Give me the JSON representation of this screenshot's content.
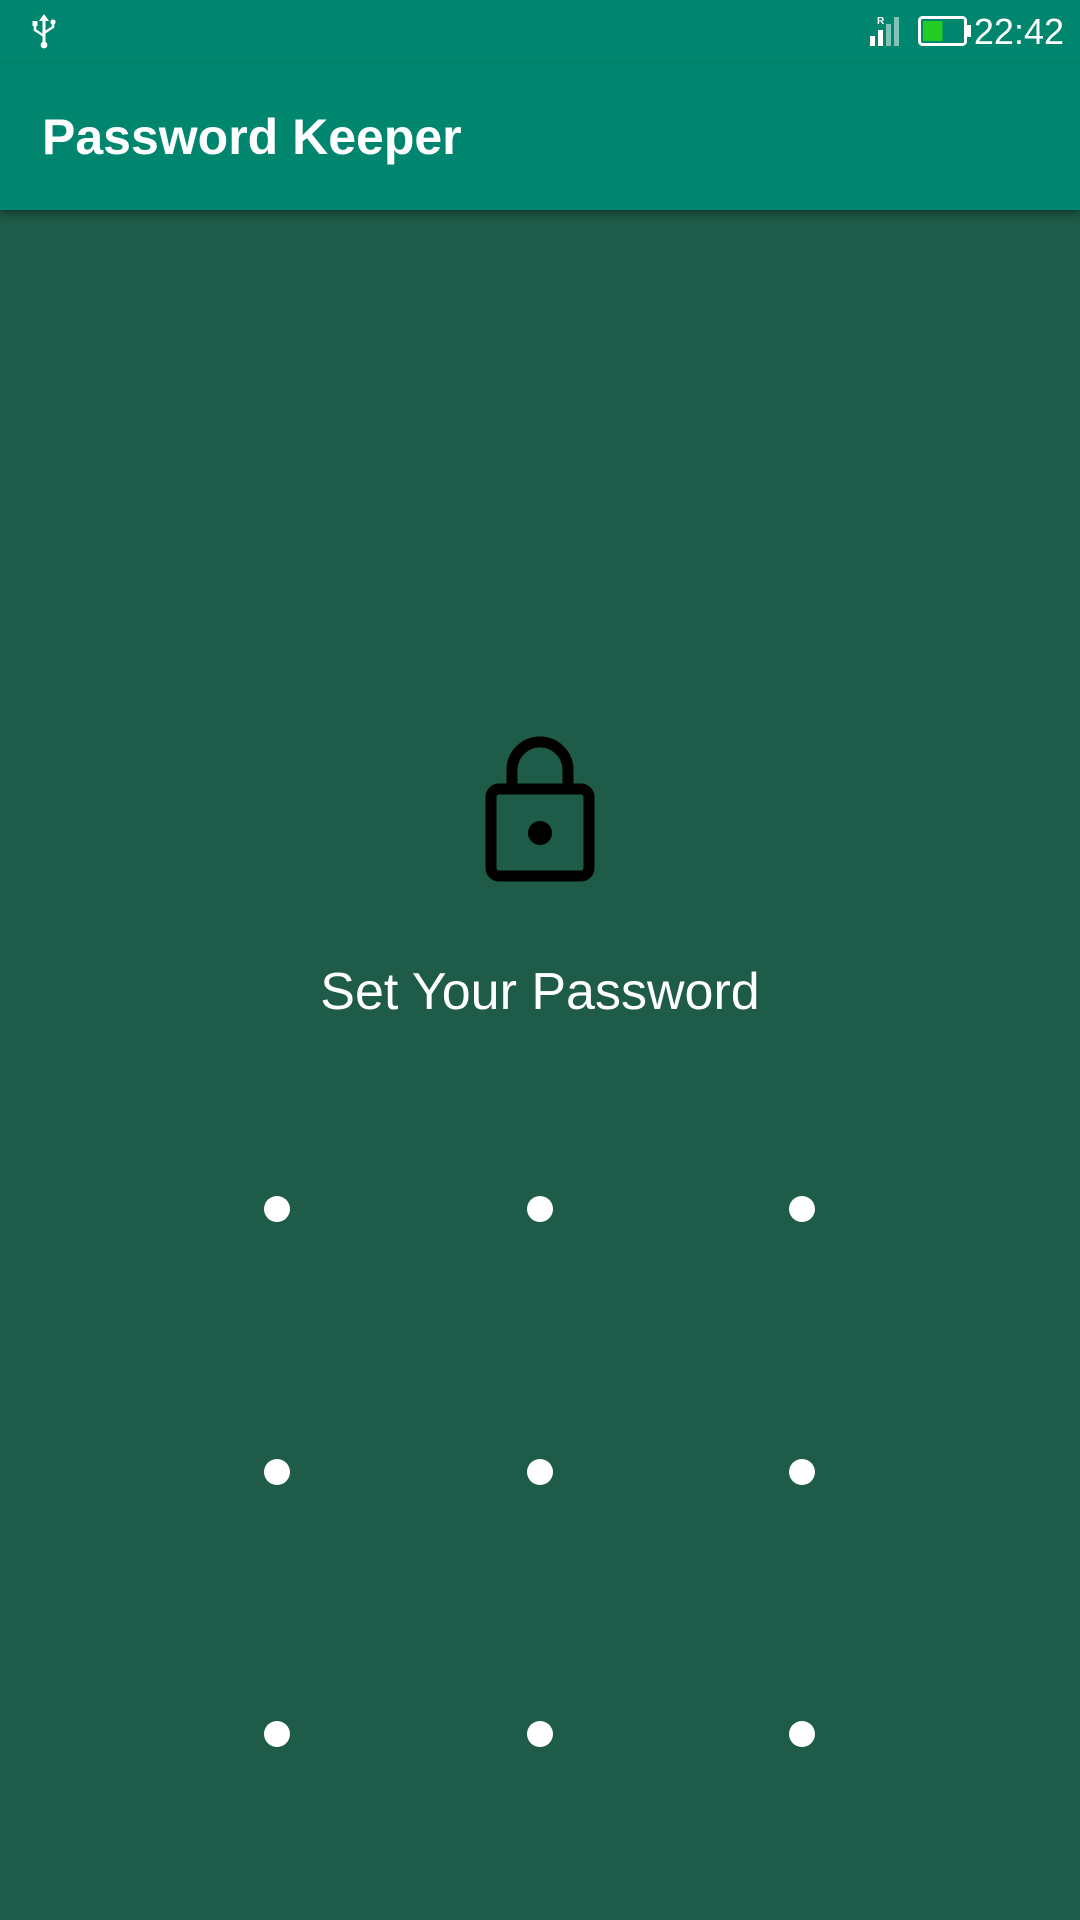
{
  "status_bar": {
    "time": "22:42",
    "icons": {
      "usb": "usb-icon",
      "signal": "signal-icon",
      "signal_badge": "R",
      "battery": "battery-icon"
    },
    "battery_level": 0.5,
    "battery_color": "#22cc22"
  },
  "app_bar": {
    "title": "Password Keeper",
    "color": "#00866f"
  },
  "main": {
    "background": "#1e5b48",
    "icon": "lock-icon",
    "prompt": "Set Your Password",
    "pattern": {
      "rows": 3,
      "cols": 3,
      "dot_color": "#ffffff"
    }
  }
}
